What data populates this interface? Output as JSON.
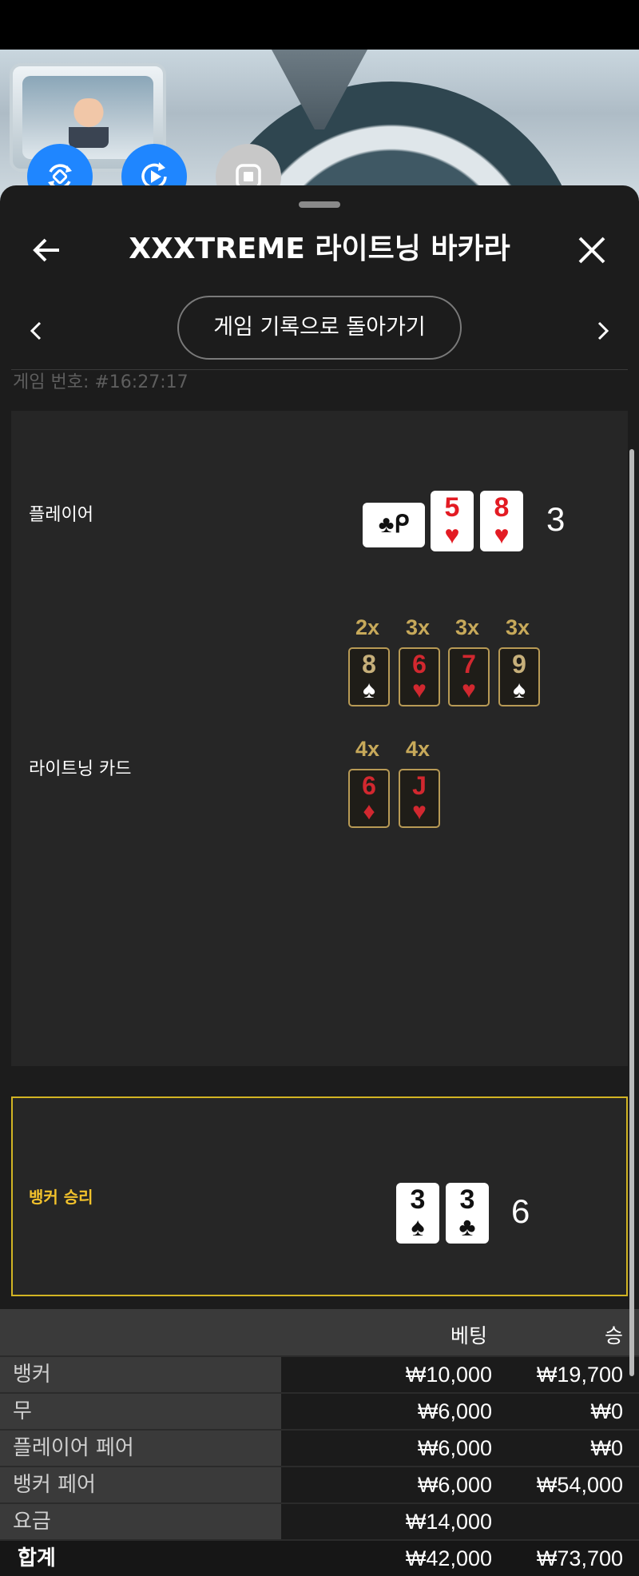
{
  "header": {
    "title": "XXXTREME 라이트닝 바카라"
  },
  "nav": {
    "back_to_history": "게임 기록으로 돌아가기"
  },
  "game": {
    "number_label": "게임 번호: #16:27:17"
  },
  "rows": {
    "player_label": "플레이어",
    "lightning_label": "라이트닝 카드",
    "banker_label": "뱅커 승리"
  },
  "player": {
    "score": "3",
    "cards": [
      {
        "rank": "♣",
        "suit": "ᑭ",
        "color": "black",
        "orientation": "horizontal"
      },
      {
        "rank": "5",
        "suit": "♥",
        "color": "#e31b23"
      },
      {
        "rank": "8",
        "suit": "♥",
        "color": "#e31b23"
      }
    ]
  },
  "lightning": {
    "row1": [
      {
        "mult": "2x",
        "rank": "8",
        "suit": "♠"
      },
      {
        "mult": "3x",
        "rank": "6",
        "suit": "♥"
      },
      {
        "mult": "3x",
        "rank": "7",
        "suit": "♥"
      },
      {
        "mult": "3x",
        "rank": "9",
        "suit": "♠"
      }
    ],
    "row2": [
      {
        "mult": "4x",
        "rank": "6",
        "suit": "♦"
      },
      {
        "mult": "4x",
        "rank": "J",
        "suit": "♥"
      }
    ]
  },
  "banker": {
    "score": "6",
    "cards": [
      {
        "rank": "3",
        "suit": "♠"
      },
      {
        "rank": "3",
        "suit": "♣"
      }
    ]
  },
  "bets": {
    "col_bet": "베팅",
    "col_win": "승",
    "rows": [
      {
        "name": "뱅커",
        "bet": "₩10,000",
        "win": "₩19,700"
      },
      {
        "name": "무",
        "bet": "₩6,000",
        "win": "₩0"
      },
      {
        "name": "플레이어 페어",
        "bet": "₩6,000",
        "win": "₩0"
      },
      {
        "name": "뱅커 페어",
        "bet": "₩6,000",
        "win": "₩54,000"
      },
      {
        "name": "요금",
        "bet": "₩14,000",
        "win": ""
      }
    ],
    "total": {
      "name": "합계",
      "bet": "₩42,000",
      "win": "₩73,700"
    }
  },
  "colors": {
    "accent_blue": "#1f86ff",
    "win_gold": "#f2c22c",
    "lightning_gold": "#c7a95a",
    "card_red": "#e31b23"
  }
}
